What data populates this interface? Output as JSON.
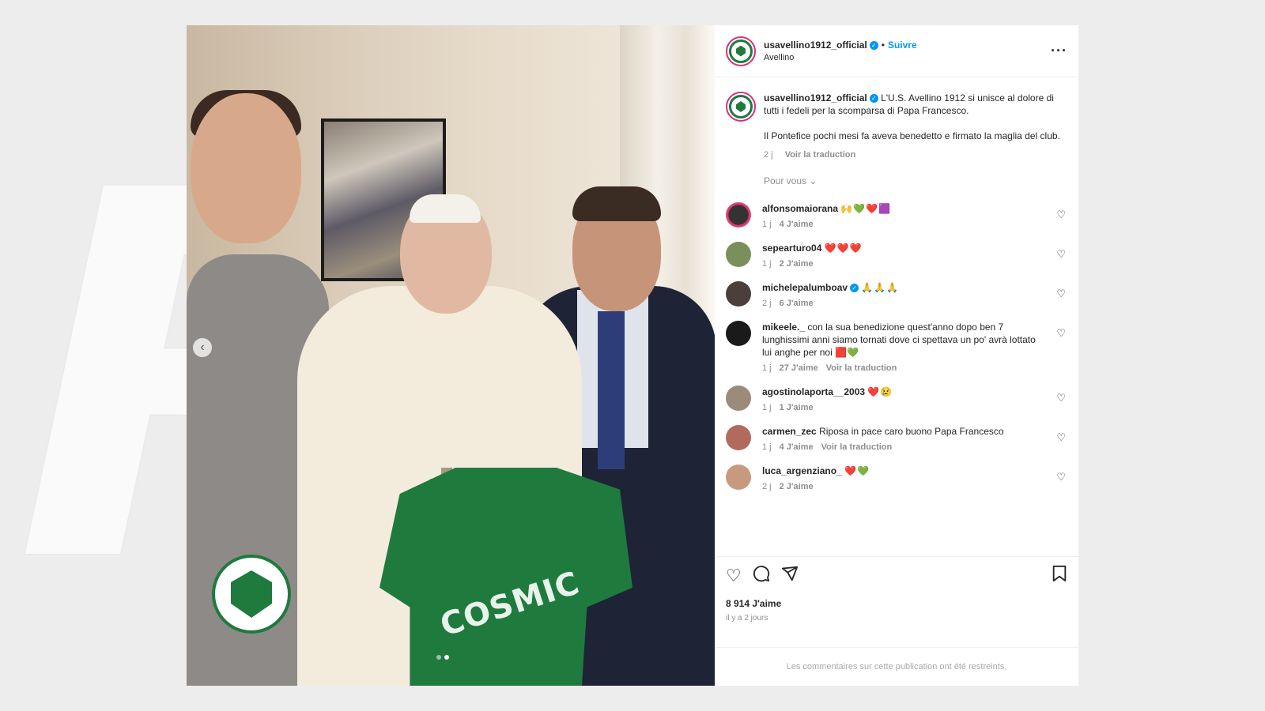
{
  "post": {
    "account": {
      "username": "usavellino1912_official",
      "verified_glyph": "✓",
      "separator": "•",
      "follow_label": "Suivre",
      "location": "Avellino",
      "more_icon": "more-horizontal-icon"
    },
    "caption": {
      "username": "usavellino1912_official",
      "text_1": "L'U.S. Avellino 1912 si unisce al dolore di tutti i fedeli per la scomparsa di Papa Francesco.",
      "text_2": "Il Pontefice pochi mesi fa aveva benedetto e firmato la maglia del club.",
      "time": "2 j",
      "translate": "Voir la traduction"
    },
    "for_you_label": "Pour vous ⌄",
    "photo": {
      "jersey_text": "COSMIC",
      "carousel_prev": "‹"
    },
    "comments": [
      {
        "username": "alfonsomaiorana",
        "text": "🙌💚❤️🟪",
        "time": "1 j",
        "likes": "4 J'aime",
        "translate": ""
      },
      {
        "username": "sepearturo04",
        "text": "❤️❤️❤️",
        "time": "1 j",
        "likes": "2 J'aime",
        "translate": ""
      },
      {
        "username": "michelepalumboav",
        "text": "🙏🙏🙏",
        "time": "2 j",
        "likes": "6 J'aime",
        "translate": "",
        "verified": true
      },
      {
        "username": "mikeele._",
        "text": "con la sua benedizione quest'anno dopo ben 7 lunghissimi anni siamo tornati dove ci spettava un po' avrà lottato lui anghe per noi 🟥💚",
        "time": "1 j",
        "likes": "27 J'aime",
        "translate": "Voir la traduction"
      },
      {
        "username": "agostinolaporta__2003",
        "text": "❤️😢",
        "time": "1 j",
        "likes": "1 J'aime",
        "translate": ""
      },
      {
        "username": "carmen_zec",
        "text": "Riposa in pace caro buono Papa Francesco",
        "time": "1 j",
        "likes": "4 J'aime",
        "translate": "Voir la traduction"
      },
      {
        "username": "luca_argenziano_",
        "text": "❤️💚",
        "time": "2 j",
        "likes": "2 J'aime",
        "translate": ""
      }
    ],
    "actions": {
      "like_icon": "heart-icon",
      "comment_icon": "comment-icon",
      "share_icon": "send-icon",
      "save_icon": "bookmark-icon"
    },
    "likes_count": "8 914 J'aime",
    "posted_ago": "il y a 2 jours",
    "comments_restricted": "Les commentaires sur cette publication ont été restreints."
  },
  "colors": {
    "brand_green": "#1f7a3e",
    "link_blue": "#0095f6",
    "muted": "#8e8e8e"
  }
}
